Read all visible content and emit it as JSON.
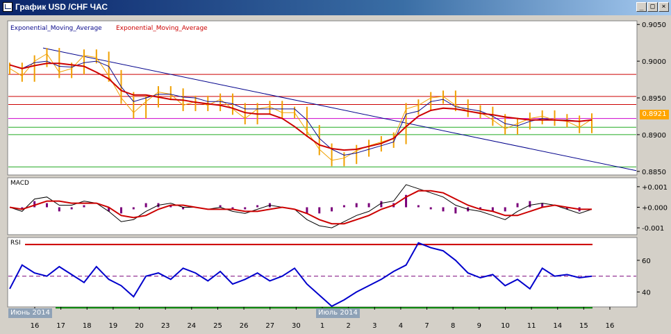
{
  "window": {
    "title": "График USD /CHF ЧАС",
    "buttons": {
      "minimize": "_",
      "maximize": "□",
      "close": "×"
    }
  },
  "price_panel": {
    "legend": {
      "ema_fast": "Exponential_Moving_Average",
      "ema_slow": "Exponential_Moving_Average"
    },
    "current_price": "0.8921"
  },
  "macd_panel": {
    "label": "MACD"
  },
  "rsi_panel": {
    "label": "RSI"
  },
  "month_labels": [
    "Июнь 2014",
    "Июль 2014"
  ],
  "colors": {
    "background": "#ffffff",
    "price_bars": "#f0a000",
    "ema_fast": "#0a0a8c",
    "ema_slow": "#cc0000",
    "hline_red": "#cc0000",
    "hline_magenta": "#cc00cc",
    "hline_green": "#22aa22",
    "trendline": "#00008b",
    "macd_hist": "#7a007a",
    "rsi_line": "#0000cc",
    "rsi_upper": "#cc0000",
    "rsi_lower": "#008800",
    "rsi_mid": "#7a007a"
  },
  "chart_data": [
    {
      "type": "line",
      "name": "price",
      "x_tick_labels": [
        "16",
        "17",
        "18",
        "19",
        "20",
        "23",
        "24",
        "25",
        "26",
        "27",
        "30",
        "1",
        "2",
        "3",
        "4",
        "7",
        "8",
        "9",
        "10",
        "11",
        "14",
        "15",
        "16"
      ],
      "y_tick_labels": [
        "0.9050",
        "0.9000",
        "0.8950",
        "0.8900",
        "0.8850"
      ],
      "ylim": [
        0.8846,
        0.9054
      ],
      "series": [
        {
          "name": "Exponential_Moving_Average",
          "color": "#0a0a8c",
          "values": [
            0.8995,
            0.899,
            0.8998,
            0.9,
            0.8993,
            0.8992,
            0.8998,
            0.9,
            0.8993,
            0.8965,
            0.8945,
            0.895,
            0.8955,
            0.8955,
            0.8951,
            0.895,
            0.8945,
            0.8945,
            0.8942,
            0.8935,
            0.8935,
            0.8935,
            0.8935,
            0.8935,
            0.892,
            0.8895,
            0.888,
            0.8872,
            0.8875,
            0.888,
            0.8885,
            0.889,
            0.8928,
            0.8932,
            0.8945,
            0.8948,
            0.8938,
            0.8935,
            0.8932,
            0.8925,
            0.8915,
            0.8912,
            0.8918,
            0.8922,
            0.892,
            0.892,
            0.8918,
            0.892
          ]
        },
        {
          "name": "Exponential_Moving_Average",
          "color": "#cc0000",
          "values": [
            0.8995,
            0.899,
            0.8994,
            0.8997,
            0.8997,
            0.8995,
            0.8993,
            0.8985,
            0.8976,
            0.896,
            0.8954,
            0.8954,
            0.8951,
            0.8948,
            0.8947,
            0.8944,
            0.8942,
            0.894,
            0.8936,
            0.893,
            0.8928,
            0.8928,
            0.8922,
            0.8911,
            0.8898,
            0.8886,
            0.8881,
            0.8879,
            0.888,
            0.8884,
            0.8888,
            0.8895,
            0.8911,
            0.8925,
            0.8933,
            0.8936,
            0.8935,
            0.8932,
            0.8929,
            0.8927,
            0.8924,
            0.8922,
            0.892,
            0.892,
            0.892,
            0.8919,
            0.8918,
            0.892
          ]
        },
        {
          "name": "price",
          "color": "#f0a000",
          "values": [
            0.899,
            0.898,
            0.9,
            0.901,
            0.8985,
            0.899,
            0.9008,
            0.9005,
            0.898,
            0.895,
            0.893,
            0.8945,
            0.8958,
            0.8955,
            0.894,
            0.8945,
            0.894,
            0.8948,
            0.8935,
            0.8922,
            0.8935,
            0.8938,
            0.893,
            0.893,
            0.8905,
            0.888,
            0.8865,
            0.8868,
            0.8878,
            0.8885,
            0.889,
            0.8895,
            0.8935,
            0.894,
            0.895,
            0.8952,
            0.894,
            0.8932,
            0.893,
            0.892,
            0.8908,
            0.8915,
            0.8922,
            0.8925,
            0.892,
            0.8918,
            0.891,
            0.8921
          ]
        }
      ],
      "hlines": [
        {
          "y": 0.8982,
          "color": "#cc0000"
        },
        {
          "y": 0.8952,
          "color": "#cc0000"
        },
        {
          "y": 0.8941,
          "color": "#cc0000"
        },
        {
          "y": 0.8922,
          "color": "#cc00cc"
        },
        {
          "y": 0.891,
          "color": "#22aa22"
        },
        {
          "y": 0.89,
          "color": "#22aa22"
        },
        {
          "y": 0.8856,
          "color": "#22aa22"
        }
      ],
      "trendline": {
        "from": [
          0,
          0.9018
        ],
        "to": [
          47,
          0.8851
        ],
        "color": "#00008b"
      }
    },
    {
      "type": "line",
      "name": "MACD",
      "y_tick_labels": [
        "+0.001",
        "+0.000",
        "-0.001"
      ],
      "ylim": [
        -0.0013,
        0.0014
      ],
      "series": [
        {
          "name": "MACD",
          "color": "#000000",
          "values": [
            0.0,
            -0.0002,
            0.0004,
            0.0005,
            0.0001,
            0.0001,
            0.0003,
            0.0002,
            -0.0002,
            -0.0007,
            -0.0006,
            -0.0002,
            0.0001,
            0.0002,
            0.0,
            0.0,
            -0.0001,
            0.0,
            -0.0002,
            -0.0003,
            -0.0001,
            0.0001,
            0.0,
            -0.0001,
            -0.0006,
            -0.0009,
            -0.001,
            -0.0007,
            -0.0004,
            -0.0002,
            0.0002,
            0.0003,
            0.0011,
            0.0009,
            0.0007,
            0.0005,
            0.0001,
            -0.0001,
            -0.0002,
            -0.0004,
            -0.0006,
            -0.0002,
            0.0001,
            0.0002,
            0.0001,
            -0.0001,
            -0.0003,
            -0.0001
          ]
        },
        {
          "name": "Signal",
          "color": "#cc0000",
          "values": [
            0.0,
            -0.0001,
            0.0001,
            0.0003,
            0.0003,
            0.0002,
            0.0002,
            0.0002,
            0.0,
            -0.0004,
            -0.0005,
            -0.0004,
            -0.0001,
            0.0001,
            0.0001,
            0.0,
            -0.0001,
            -0.0001,
            -0.0001,
            -0.0002,
            -0.0002,
            -0.0001,
            0.0,
            -0.0001,
            -0.0003,
            -0.0006,
            -0.0008,
            -0.0008,
            -0.0006,
            -0.0004,
            -0.0001,
            0.0001,
            0.0005,
            0.0008,
            0.0008,
            0.0007,
            0.0004,
            0.0001,
            -0.0001,
            -0.0002,
            -0.0004,
            -0.0004,
            -0.0002,
            0.0,
            0.0001,
            0.0,
            -0.0001,
            -0.0001
          ]
        }
      ]
    },
    {
      "type": "line",
      "name": "RSI",
      "y_tick_labels": [
        "60",
        "40"
      ],
      "ylim": [
        31,
        74
      ],
      "levels": {
        "upper": 70,
        "mid": 50,
        "lower": 30
      },
      "series": [
        {
          "name": "RSI",
          "color": "#0000cc",
          "values": [
            42,
            57,
            52,
            50,
            56,
            51,
            46,
            56,
            48,
            44,
            37,
            50,
            52,
            48,
            55,
            52,
            47,
            53,
            45,
            48,
            52,
            47,
            50,
            55,
            45,
            38,
            31,
            35,
            40,
            44,
            48,
            53,
            57,
            71,
            68,
            66,
            60,
            52,
            49,
            51,
            44,
            48,
            42,
            55,
            50,
            51,
            49,
            50
          ]
        }
      ]
    }
  ]
}
